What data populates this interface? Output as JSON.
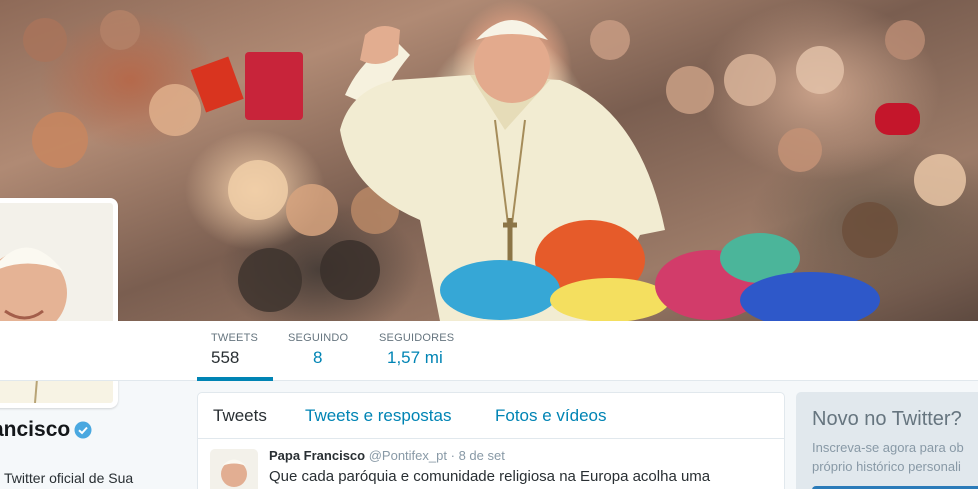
{
  "header": {
    "photo_icon": "crowd-photo"
  },
  "stats": [
    {
      "label": "TWEETS",
      "value": "558"
    },
    {
      "label": "SEGUINDO",
      "value": "8"
    },
    {
      "label": "SEGUIDORES",
      "value": "1,57 mi"
    }
  ],
  "profile": {
    "name": "ancisco",
    "bio": "Twitter oficial de Sua",
    "verified_icon": "verified-badge-icon"
  },
  "timeline": {
    "tabs": [
      {
        "label": "Tweets"
      },
      {
        "label": "Tweets e respostas"
      },
      {
        "label": "Fotos e vídeos"
      }
    ],
    "tweet": {
      "name": "Papa Francisco",
      "handle": "@Pontifex_pt",
      "separator": "·",
      "date": "8 de set",
      "text": "Que cada paróquia e comunidade religiosa na Europa acolha uma"
    }
  },
  "signup": {
    "title": "Novo no Twitter?",
    "line1": "Inscreva-se agora para ob",
    "line2": "próprio histórico personali"
  },
  "colors": {
    "link": "#0084b4",
    "text": "#292f33",
    "muted": "#66757f",
    "border": "#e1e8ed"
  }
}
